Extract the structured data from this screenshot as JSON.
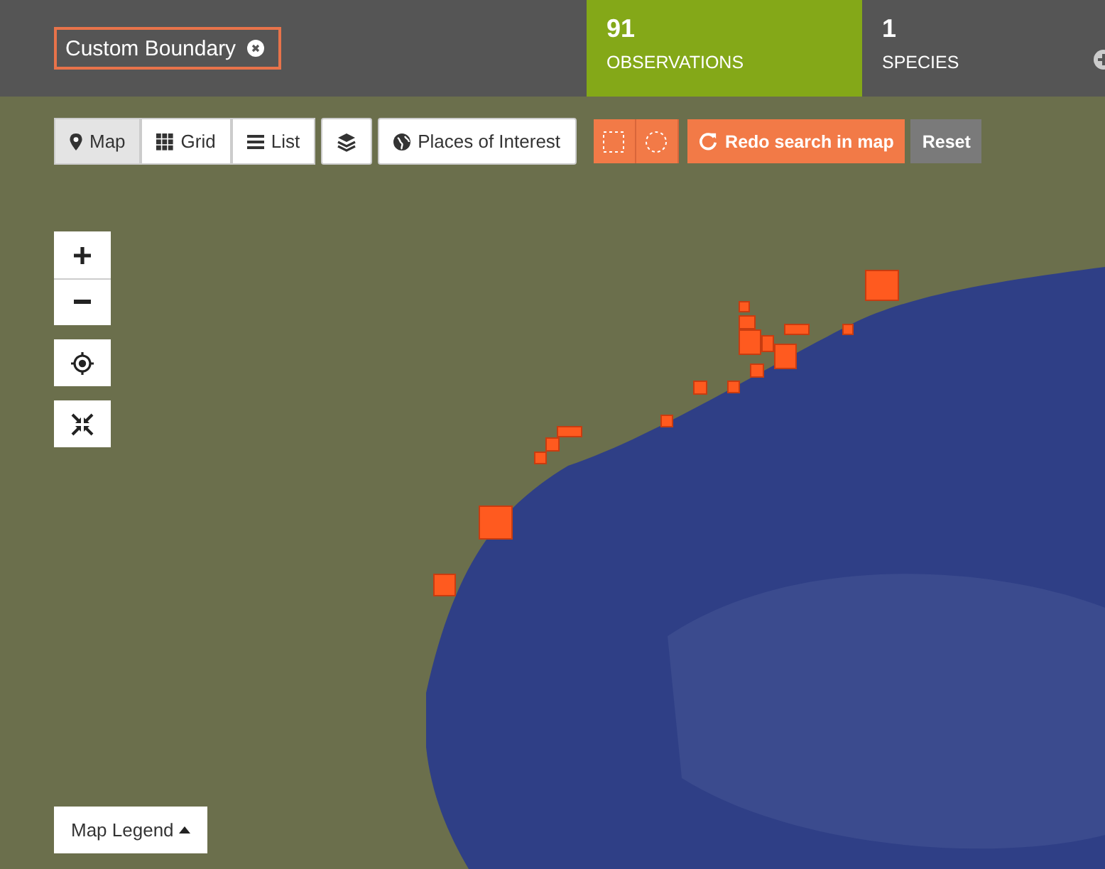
{
  "filter": {
    "label": "Custom Boundary"
  },
  "stats": [
    {
      "count": "91",
      "label": "OBSERVATIONS",
      "selected": true
    },
    {
      "count": "1",
      "label": "SPECIES",
      "selected": false
    }
  ],
  "view_tabs": [
    {
      "label": "Map",
      "kind": "map",
      "selected": true
    },
    {
      "label": "Grid",
      "kind": "grid",
      "selected": false
    },
    {
      "label": "List",
      "kind": "list",
      "selected": false
    }
  ],
  "places_button": {
    "label": "Places of Interest"
  },
  "redo_button": {
    "label": "Redo search in map"
  },
  "reset_button": {
    "label": "Reset"
  },
  "legend_button": {
    "label": "Map Legend"
  }
}
